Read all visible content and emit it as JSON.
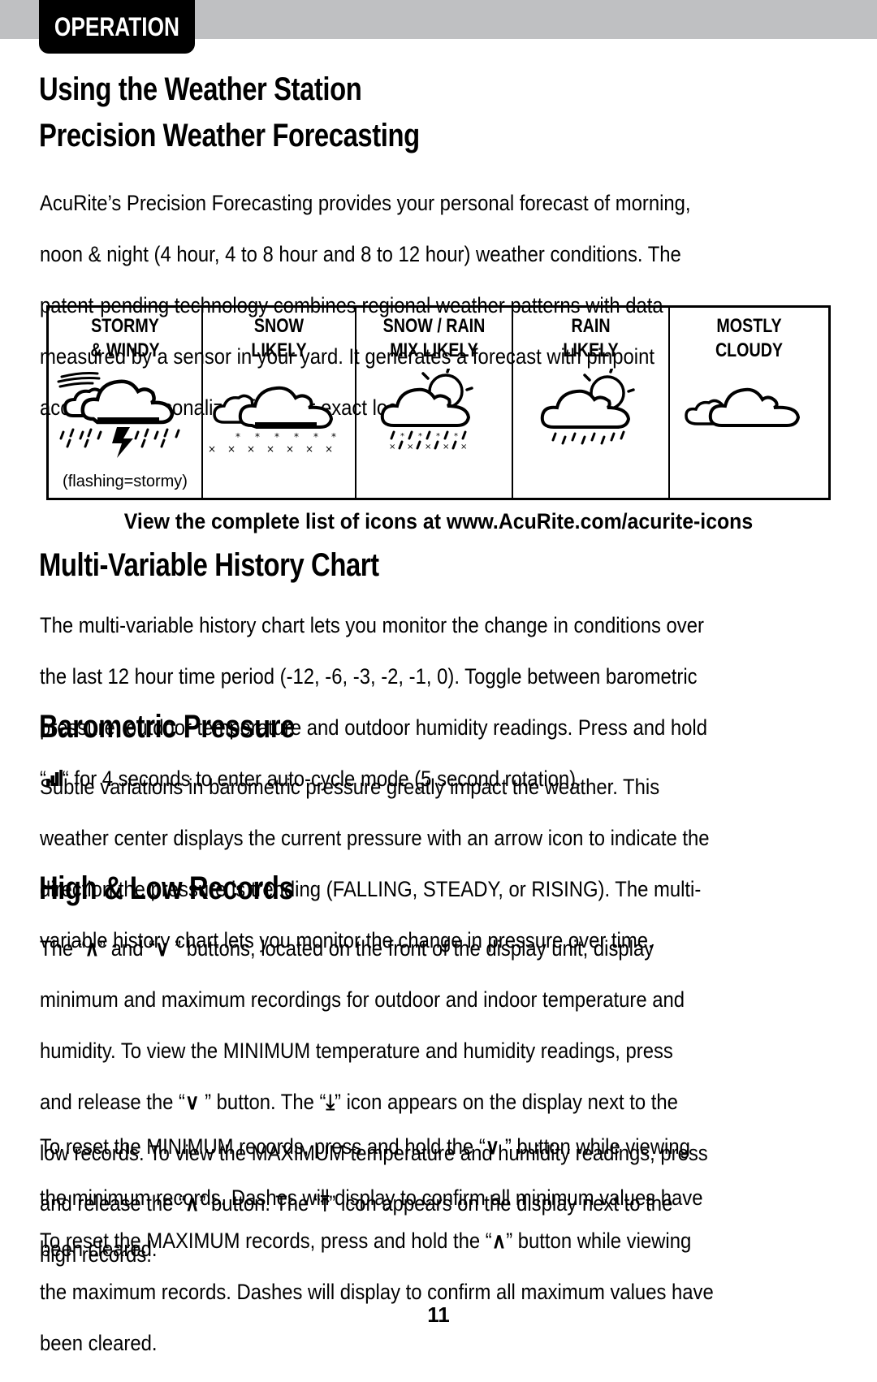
{
  "header": {
    "section_tab": "OPERATION"
  },
  "headings": {
    "using": "Using the Weather Station",
    "precision": "Precision Weather Forecasting",
    "history": "Multi-Variable History Chart",
    "barometric": "Barometric Pressure",
    "records": "High & Low Records"
  },
  "precision": {
    "lines": [
      "AcuRite’s Precision Forecasting provides your personal forecast of morning,",
      "noon & night (4 hour, 4 to 8 hour and 8 to 12 hour) weather conditions. The",
      "patent-pending technology combines regional weather patterns with data",
      "measured by a sensor in your yard. It generates a forecast with pinpoint",
      "accuracy - personalized for your exact location."
    ]
  },
  "icon_table": {
    "cells": [
      {
        "title_1": "STORMY",
        "title_2": "& WINDY",
        "icon": "stormy-windy-icon",
        "note": "(flashing=stormy)"
      },
      {
        "title_1": "SNOW",
        "title_2": "LIKELY",
        "icon": "snow-likely-icon",
        "note": ""
      },
      {
        "title_1": "SNOW / RAIN",
        "title_2": "MIX LIKELY",
        "icon": "snow-rain-mix-icon",
        "note": ""
      },
      {
        "title_1": "RAIN",
        "title_2": "LIKELY",
        "icon": "rain-likely-icon",
        "note": ""
      },
      {
        "title_1": "MOSTLY",
        "title_2": "CLOUDY",
        "icon": "mostly-cloudy-icon",
        "note": ""
      }
    ],
    "caption": "View the complete list of icons at www.AcuRite.com/acurite-icons"
  },
  "history": {
    "lines": [
      "The multi-variable history chart lets you monitor the change in conditions over",
      "the last 12 hour time period (-12, -6, -3, -2, -1, 0). Toggle between barometric",
      "pressure, outdoor temperature and outdoor humidity readings. Press and hold"
    ],
    "last_prefix": "“",
    "last_suffix": "“ for 4 seconds to enter auto-cycle mode (5 second rotation)."
  },
  "barometric": {
    "lines": [
      "Subtle variations in barometric pressure greatly impact the weather. This",
      "weather center displays the current pressure with an arrow icon to indicate the",
      "direction the pressure is trending (FALLING, STEADY, or RISING). The multi-",
      "variable history chart lets you monitor the change in pressure over time."
    ]
  },
  "records": {
    "p1": {
      "l1a": "The “",
      "l1b": "” and “",
      "l1c": " ” buttons, located on the front of the display unit, display",
      "l2": "minimum and maximum recordings for outdoor and indoor temperature and",
      "l3": "humidity. To view the MINIMUM temperature and humidity readings, press",
      "l4a": "and release the “",
      "l4b": " ” button. The “",
      "l4c": "” icon appears on the display next to the",
      "l5": "low records. To view the MAXIMUM temperature and humidity readings, press",
      "l6a": "and release the “",
      "l6b": "” button. The “",
      "l6c": "” icon appears on the display next to the",
      "l7": "high records."
    },
    "p2": {
      "l1a": "To reset the MINIMUM records, press and hold the “",
      "l1b": " ” button while viewing",
      "l2": "the minimum records. Dashes will display to confirm all minimum values have",
      "l3": "been cleared."
    },
    "p3": {
      "l1a": "To reset the MAXIMUM records, press and hold the “",
      "l1b": "” button while viewing",
      "l2": "the maximum records. Dashes will display to confirm all maximum values have",
      "l3": "been cleared."
    },
    "glyphs": {
      "up": "∧",
      "down": "∨",
      "low": "⤓",
      "high": "⤒"
    }
  },
  "footer": {
    "page_number": "11"
  }
}
